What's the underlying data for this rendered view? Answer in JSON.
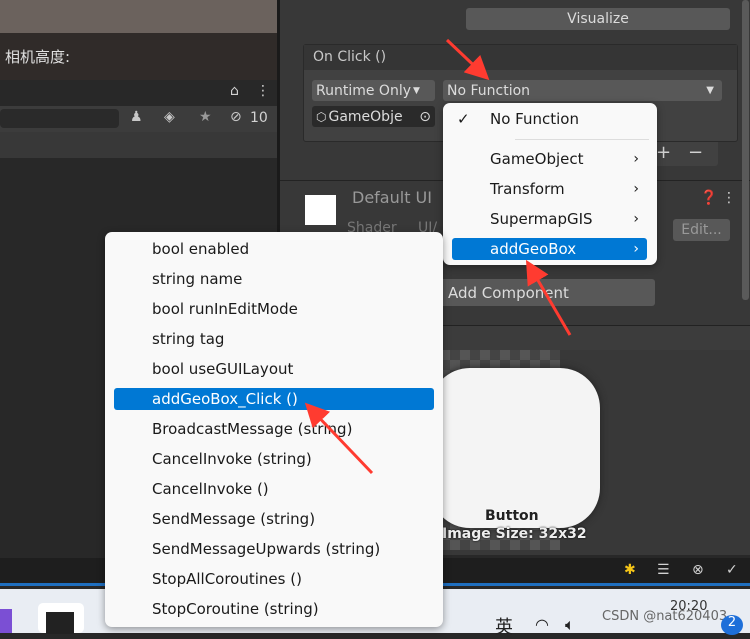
{
  "scene": {
    "camera_height_label": "相机高度:"
  },
  "hierarchy": {
    "hidden_count": "10"
  },
  "inspector": {
    "visualize_label": "Visualize",
    "on_click_header": "On Click ()",
    "runtime_dropdown": "Runtime Only",
    "function_dropdown": "No Function",
    "object_field": "GameObje",
    "add_label": "+",
    "remove_label": "−",
    "material_name": "Default UI",
    "shader_label": "Shader",
    "shader_value": "UI/",
    "edit_label": "Edit...",
    "add_component_label": "Add Component",
    "preview_caption": "Button",
    "preview_size": "Image Size: 32x32"
  },
  "function_menu": {
    "items": [
      {
        "label": "No Function",
        "checked": true
      },
      {
        "label": "GameObject",
        "submenu": true
      },
      {
        "label": "Transform",
        "submenu": true
      },
      {
        "label": "SupermapGIS",
        "submenu": true
      },
      {
        "label": "addGeoBox",
        "submenu": true,
        "highlighted": true
      }
    ]
  },
  "submenu": {
    "items": [
      "bool enabled",
      "string name",
      "bool runInEditMode",
      "string tag",
      "bool useGUILayout",
      "addGeoBox_Click ()",
      "BroadcastMessage (string)",
      "CancelInvoke (string)",
      "CancelInvoke ()",
      "SendMessage (string)",
      "SendMessageUpwards (string)",
      "StopAllCoroutines ()",
      "StopCoroutine (string)"
    ],
    "highlighted_index": 5
  },
  "taskbar": {
    "ime": "英",
    "watermark": "CSDN @nat620403",
    "time": "20:20",
    "badge": "2"
  },
  "colors": {
    "highlight": "#0078d4",
    "arrow": "#ff3b30"
  }
}
